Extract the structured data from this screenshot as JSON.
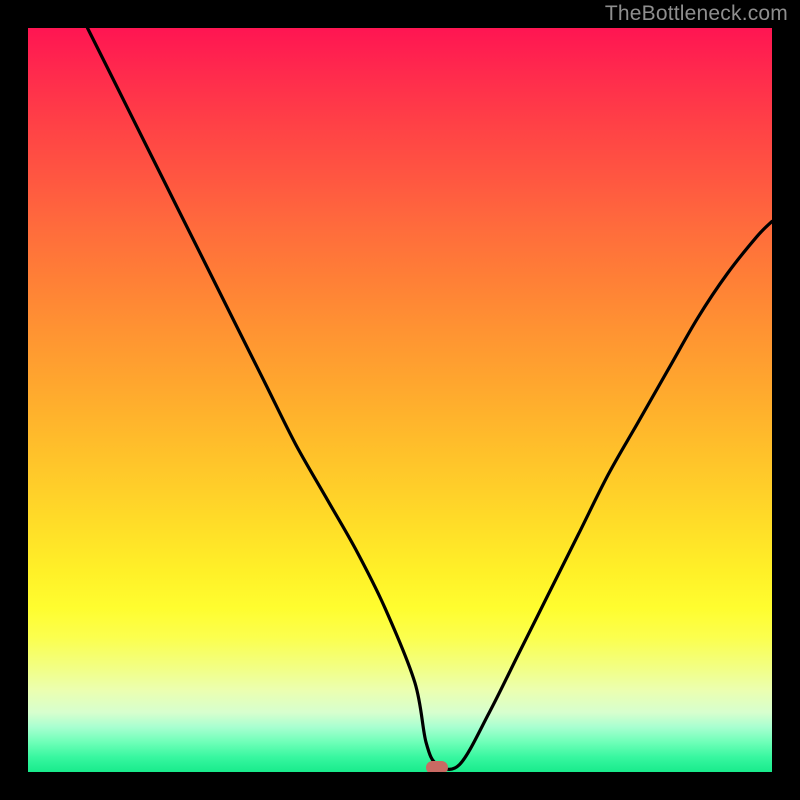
{
  "watermark": "TheBottleneck.com",
  "chart_data": {
    "type": "line",
    "title": "",
    "xlabel": "",
    "ylabel": "",
    "xlim": [
      0,
      100
    ],
    "ylim": [
      0,
      100
    ],
    "grid": false,
    "legend": false,
    "series": [
      {
        "name": "bottleneck-curve",
        "x": [
          8,
          12,
          16,
          20,
          24,
          28,
          32,
          36,
          40,
          44,
          48,
          52,
          53.5,
          55,
          58,
          62,
          66,
          70,
          74,
          78,
          82,
          86,
          90,
          94,
          98,
          100
        ],
        "y": [
          100,
          92,
          84,
          76,
          68,
          60,
          52,
          44,
          37,
          30,
          22,
          12,
          4,
          1,
          1,
          8,
          16,
          24,
          32,
          40,
          47,
          54,
          61,
          67,
          72,
          74
        ]
      }
    ],
    "bottleneck_point": {
      "x": 55,
      "y": 0.5
    },
    "background_gradient": {
      "top": "#ff1552",
      "mid": "#ffe128",
      "bottom": "#18eb8c"
    }
  }
}
